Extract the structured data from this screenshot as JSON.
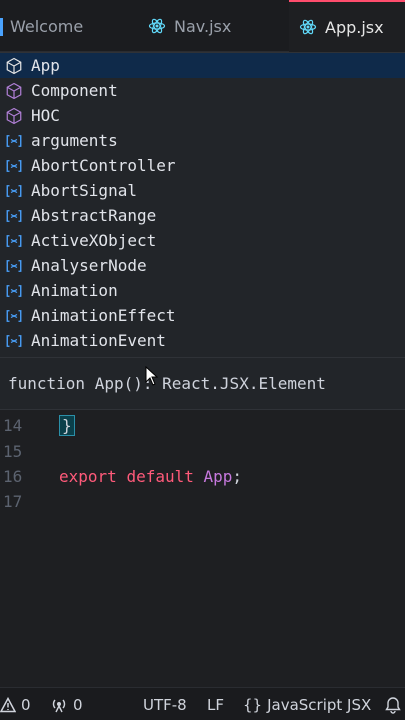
{
  "tabs": [
    {
      "label": "Welcome"
    },
    {
      "label": "Nav.jsx"
    },
    {
      "label": "App.jsx"
    }
  ],
  "suggestions": [
    {
      "label": "App",
      "kind": "class-icon"
    },
    {
      "label": "Component",
      "kind": "class-icon"
    },
    {
      "label": "HOC",
      "kind": "class-icon"
    },
    {
      "label": "arguments",
      "kind": "variable-icon"
    },
    {
      "label": "AbortController",
      "kind": "variable-icon"
    },
    {
      "label": "AbortSignal",
      "kind": "variable-icon"
    },
    {
      "label": "AbstractRange",
      "kind": "variable-icon"
    },
    {
      "label": "ActiveXObject",
      "kind": "variable-icon"
    },
    {
      "label": "AnalyserNode",
      "kind": "variable-icon"
    },
    {
      "label": "Animation",
      "kind": "variable-icon"
    },
    {
      "label": "AnimationEffect",
      "kind": "variable-icon"
    },
    {
      "label": "AnimationEvent",
      "kind": "variable-icon"
    }
  ],
  "detail": {
    "signature": "function App(): React.JSX.Element"
  },
  "editor": {
    "lines": [
      {
        "number": "14",
        "brace": "}"
      },
      {
        "number": "15"
      },
      {
        "number": "16",
        "kw1": "export",
        "kw2": "default",
        "ident": "App",
        "punct": ";"
      },
      {
        "number": "17"
      }
    ]
  },
  "status": {
    "errors": "0",
    "ports": "0",
    "encoding": "UTF-8",
    "eol": "LF",
    "braces": "{}",
    "language": "JavaScript JSX"
  },
  "colors": {
    "accent": "#ff4d6d",
    "keyword": "#ff5a7a",
    "identifier": "#c678dd",
    "react": "#61dafb",
    "class_icon": "#b180d7",
    "variable_icon": "#4aa3ff",
    "selection": "#0f2a4a"
  }
}
